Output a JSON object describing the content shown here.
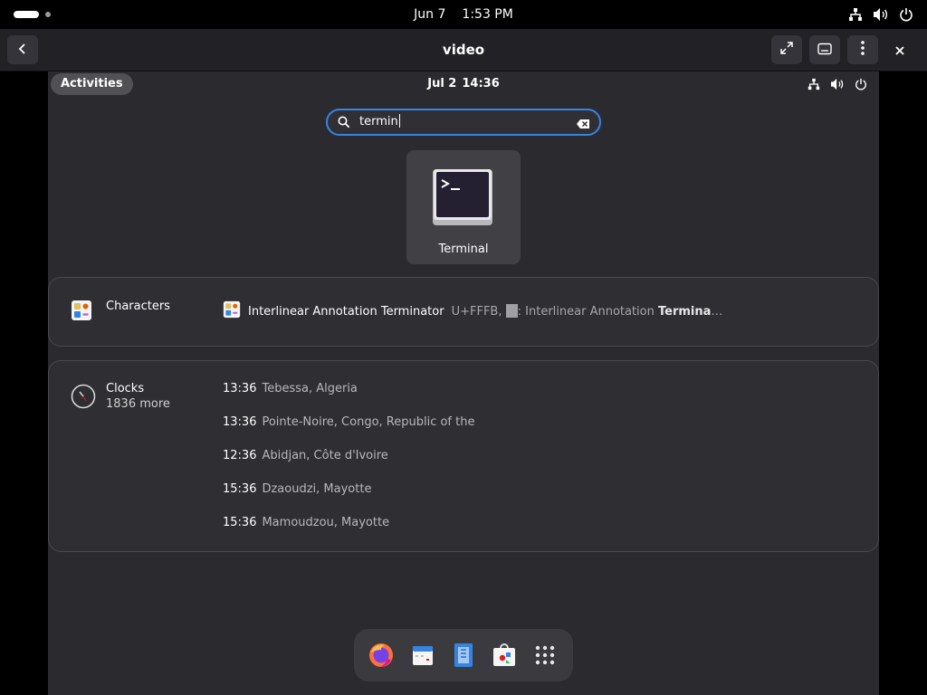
{
  "host": {
    "date": "Jun 7",
    "time": "1:53 PM",
    "window_title": "video"
  },
  "vm": {
    "activities_label": "Activities",
    "date": "Jul 2",
    "time": "14:36",
    "search_value": "termin",
    "app_result": {
      "label": "Terminal",
      "icon": "terminal-icon"
    },
    "characters": {
      "provider": "Characters",
      "result_title": "Interlinear Annotation Terminator",
      "result_code": "U+FFFB,",
      "result_colon": ":",
      "result_desc_prefix": "Interlinear Annotation",
      "result_desc_match": "Termina",
      "result_desc_suffix": "…"
    },
    "clocks": {
      "provider": "Clocks",
      "more": "1836 more",
      "rows": [
        {
          "time": "13:36",
          "place": "Tebessa, Algeria"
        },
        {
          "time": "13:36",
          "place": "Pointe-Noire, Congo, Republic of the"
        },
        {
          "time": "12:36",
          "place": "Abidjan, Côte d'Ivoire"
        },
        {
          "time": "15:36",
          "place": "Dzaoudzi, Mayotte"
        },
        {
          "time": "15:36",
          "place": "Mamoudzou, Mayotte"
        }
      ]
    },
    "dash": [
      "firefox-icon",
      "calendar-icon",
      "text-editor-icon",
      "software-store-icon",
      "app-grid-icon"
    ]
  },
  "colors": {
    "accent": "#3584e4",
    "background": "#2b2b2f",
    "card": "#2e2e33"
  }
}
